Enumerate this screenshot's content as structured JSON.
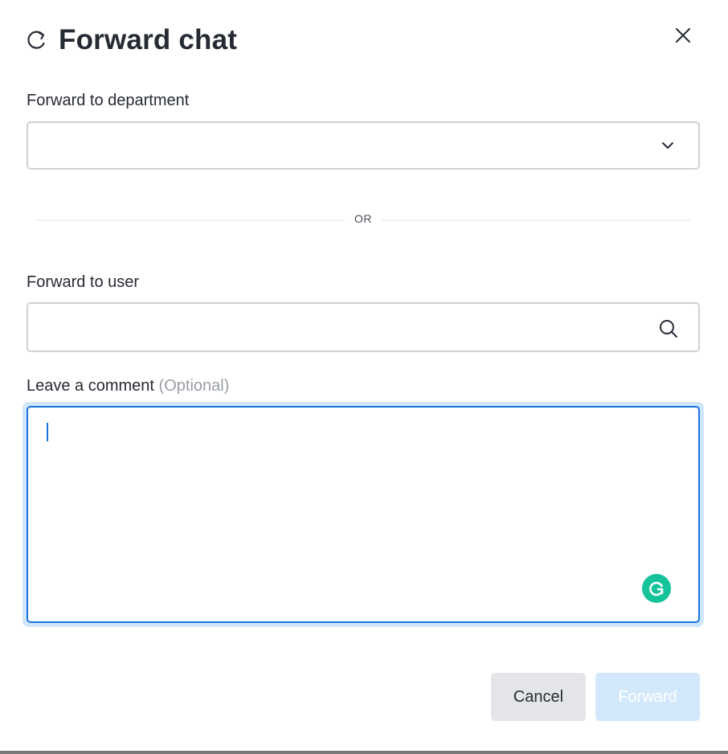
{
  "dialog": {
    "title": "Forward chat",
    "title_icon": "forward-chat-icon",
    "close_icon": "close-icon"
  },
  "department": {
    "label": "Forward to department",
    "selected_value": "",
    "icon": "chevron-down-icon"
  },
  "divider": {
    "text": "OR"
  },
  "user": {
    "label": "Forward to user",
    "value": "",
    "placeholder": "",
    "icon": "search-icon"
  },
  "comment": {
    "label": "Leave a comment",
    "optional_note": "(Optional)",
    "value": "",
    "extension_icon": "grammarly-icon"
  },
  "actions": {
    "cancel_label": "Cancel",
    "forward_label": "Forward"
  },
  "colors": {
    "accent": "#1a73e0",
    "focus_ring": "#cfe6fb",
    "forward_disabled_bg": "#d3e8fb",
    "cancel_bg": "#e4e5e8",
    "grammarly": "#15c39a",
    "text": "#262a33"
  }
}
